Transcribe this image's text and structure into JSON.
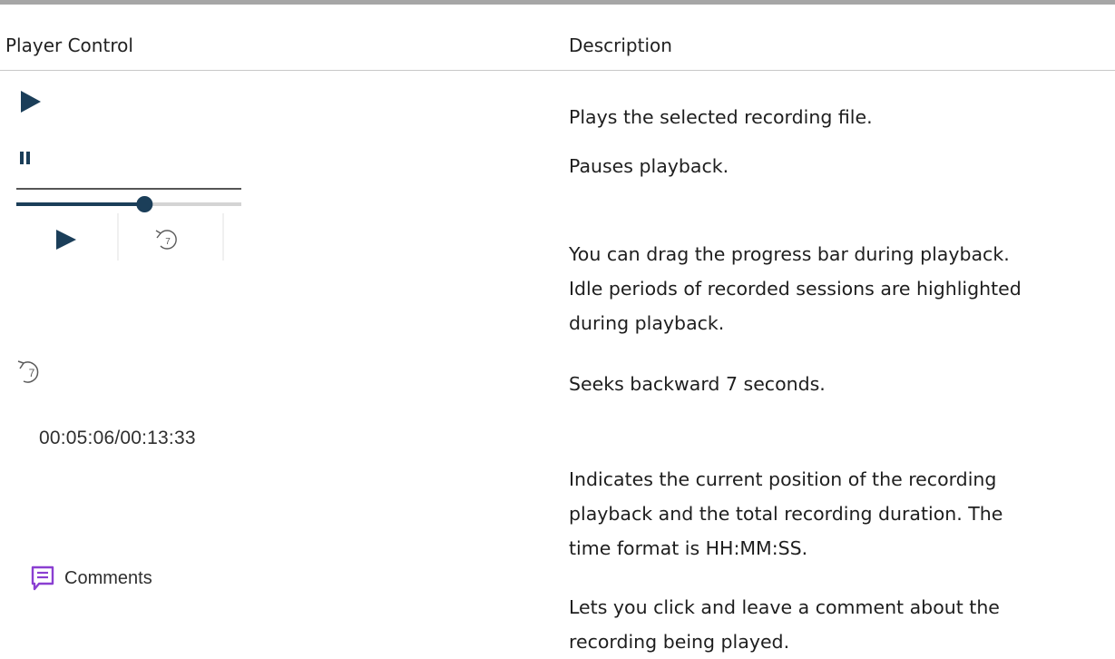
{
  "table": {
    "headers": {
      "control": "Player Control",
      "description": "Description"
    },
    "rows": [
      {
        "control_icon": "play-icon",
        "description_lines": [
          "Plays the selected recording file."
        ]
      },
      {
        "control_icon": "pause-icon",
        "description_lines": [
          "Pauses playback."
        ]
      },
      {
        "control_icon": "progress-bar",
        "progress_fraction": 0.57,
        "widget_icons": [
          "play-icon",
          "seek-back-7-icon"
        ],
        "seek_back_seconds": "7",
        "description_lines": [
          "You can drag the progress bar during playback.",
          "Idle periods of recorded sessions are highlighted",
          "during playback."
        ]
      },
      {
        "control_icon": "seek-back-7-icon",
        "seek_back_seconds": "7",
        "description_lines": [
          "Seeks backward 7 seconds."
        ]
      },
      {
        "control_text": "00:05:06/00:13:33",
        "description_lines": [
          "Indicates the current position of the recording",
          "playback and the total recording duration.  The",
          "time format is HH:MM:SS."
        ]
      },
      {
        "control_icon": "comment-icon",
        "control_text": "Comments",
        "description_lines": [
          "Lets you click and leave a comment about the",
          "recording being played."
        ]
      }
    ]
  },
  "colors": {
    "icon_primary": "#1b3e59",
    "comment_accent": "#8a3fd1",
    "text": "#1e1e1e",
    "rule": "#c8c8c8"
  }
}
